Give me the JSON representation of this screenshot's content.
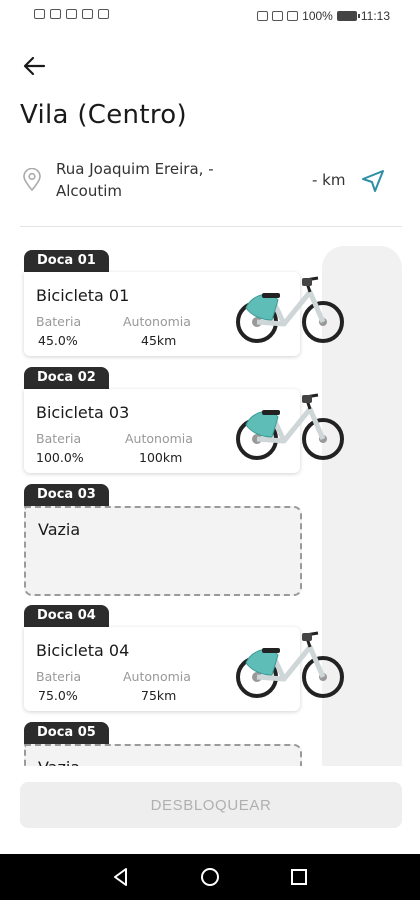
{
  "status_bar": {
    "battery": "100%",
    "time": "11:13"
  },
  "header": {
    "title": "Vila (Centro)"
  },
  "location": {
    "address": "Rua Joaquim Ereira, - Alcoutim",
    "distance": "- km"
  },
  "labels": {
    "battery": "Bateria",
    "range": "Autonomia"
  },
  "docks": [
    {
      "tag": "Doca 01",
      "name": "Bicicleta 01",
      "battery": "45.0%",
      "range": "45km"
    },
    {
      "tag": "Doca 02",
      "name": "Bicicleta 03",
      "battery": "100.0%",
      "range": "100km"
    },
    {
      "tag": "Doca 03",
      "name": "Vazia"
    },
    {
      "tag": "Doca 04",
      "name": "Bicicleta 04",
      "battery": "75.0%",
      "range": "75km"
    },
    {
      "tag": "Doca 05",
      "name": "Vazia"
    }
  ],
  "actions": {
    "unlock": "DESBLOQUEAR"
  },
  "colors": {
    "accent": "#2f8fa6",
    "bike_frame": "#cfd6d8",
    "bike_panel": "#5fbdb7"
  }
}
